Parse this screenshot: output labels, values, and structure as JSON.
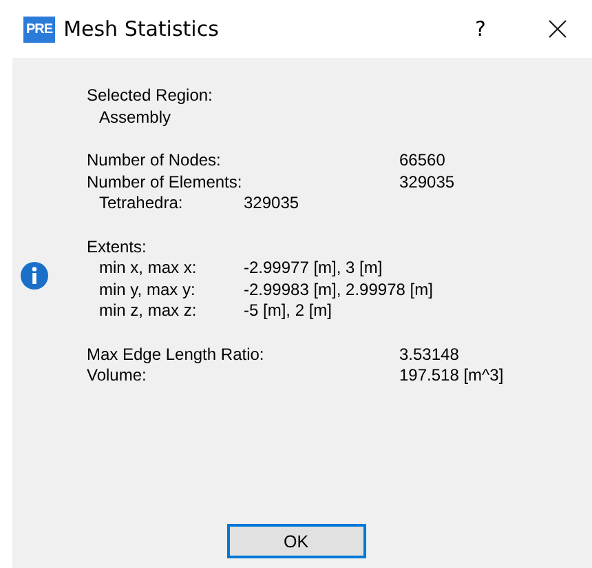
{
  "window": {
    "app_badge": "PRE",
    "title": "Mesh Statistics",
    "help": "?"
  },
  "sections": [
    {
      "kind": "plain",
      "rows": [
        {
          "kind": "label",
          "text": "Selected Region:"
        },
        {
          "kind": "sub",
          "text": "Assembly"
        }
      ]
    },
    {
      "kind": "plain",
      "rows": [
        {
          "kind": "pair",
          "label": "Number of Nodes:",
          "value": "66560"
        },
        {
          "kind": "pair",
          "label": "Number of Elements:",
          "value": "329035"
        },
        {
          "kind": "subpair",
          "label": "Tetrahedra:",
          "value": "329035"
        }
      ]
    },
    {
      "kind": "info",
      "rows": [
        {
          "kind": "label",
          "text": "Extents:"
        },
        {
          "kind": "subpair",
          "label": "min x, max x:",
          "value": "-2.99977 [m], 3 [m]"
        },
        {
          "kind": "subpair",
          "label": "min y, max y:",
          "value": "-2.99983 [m], 2.99978 [m]"
        },
        {
          "kind": "subpair",
          "label": "min z, max z:",
          "value": "-5 [m], 2 [m]"
        }
      ]
    },
    {
      "kind": "plain",
      "rows": [
        {
          "kind": "pair",
          "label": "Max Edge Length Ratio:",
          "value": "3.53148"
        },
        {
          "kind": "pair",
          "label": "Volume:",
          "value": "197.518 [m^3]"
        }
      ]
    }
  ],
  "buttons": [
    {
      "label": "OK",
      "default": true
    }
  ]
}
